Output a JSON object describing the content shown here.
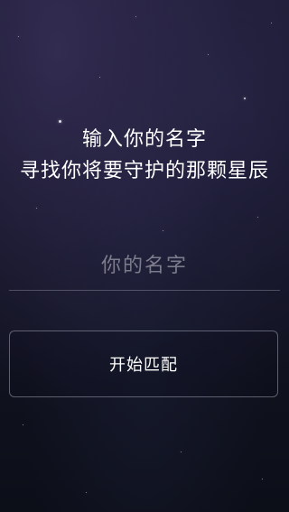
{
  "prompt": {
    "line1": "输入你的名字",
    "line2": "寻找你将要守护的那颗星辰"
  },
  "name_input": {
    "placeholder": "你的名字",
    "value": ""
  },
  "match_button": {
    "label": "开始匹配"
  },
  "colors": {
    "background_top": "#1b1930",
    "background_bottom": "#0c0e18",
    "text": "#ffffff",
    "placeholder": "#c8c8d2"
  }
}
